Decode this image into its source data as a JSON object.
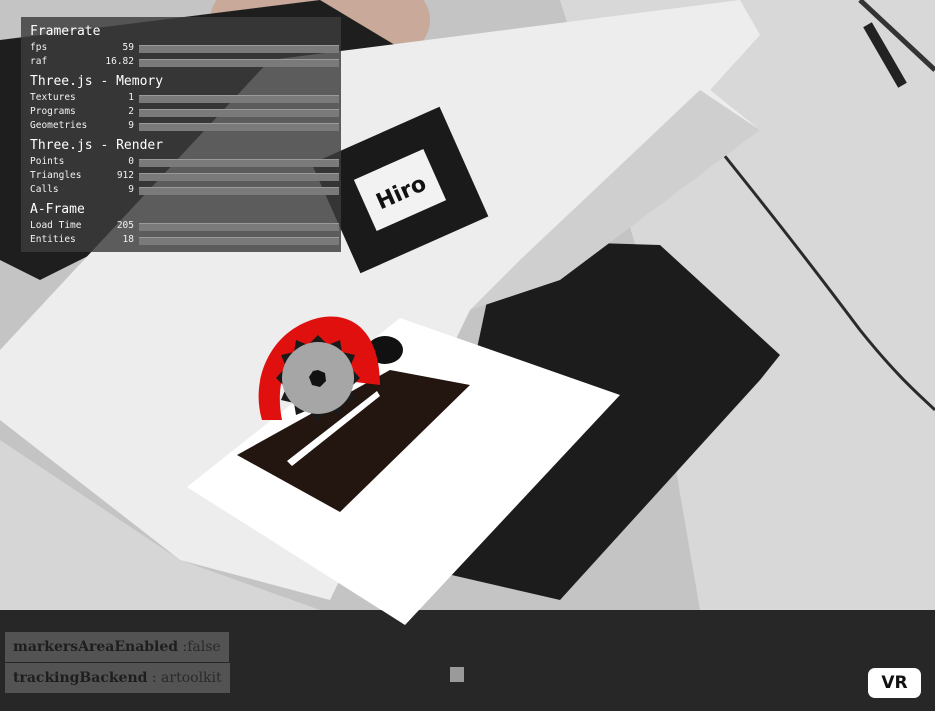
{
  "stats": {
    "sections": [
      {
        "title": "Framerate",
        "rows": [
          {
            "label": "fps",
            "value": "59",
            "fill": 0.0
          },
          {
            "label": "raf",
            "value": "16.82",
            "fill": 0.0
          }
        ]
      },
      {
        "title": "Three.js - Memory",
        "rows": [
          {
            "label": "Textures",
            "value": "1",
            "fill": 0.0
          },
          {
            "label": "Programs",
            "value": "2",
            "fill": 0.0
          },
          {
            "label": "Geometries",
            "value": "9",
            "fill": 0.0
          }
        ]
      },
      {
        "title": "Three.js - Render",
        "rows": [
          {
            "label": "Points",
            "value": "0",
            "fill": 0.0
          },
          {
            "label": "Triangles",
            "value": "912",
            "fill": 0.0
          },
          {
            "label": "Calls",
            "value": "9",
            "fill": 0.0
          }
        ]
      },
      {
        "title": "A-Frame",
        "rows": [
          {
            "label": "Load Time",
            "value": "205",
            "fill": 0.0
          },
          {
            "label": "Entities",
            "value": "18",
            "fill": 0.0
          }
        ]
      }
    ]
  },
  "info": {
    "markers_key": "markersAreaEnabled",
    "markers_value": " :false",
    "tracking_key": "trackingBackend",
    "tracking_value": " : artoolkit"
  },
  "vr_button": {
    "label": "VR"
  },
  "marker": {
    "text": "Hiro"
  },
  "colors": {
    "saw_guard": "#e0100f",
    "saw_blade": "#a6a6a6",
    "table_top": "#231510",
    "platform": "#ffffff"
  }
}
